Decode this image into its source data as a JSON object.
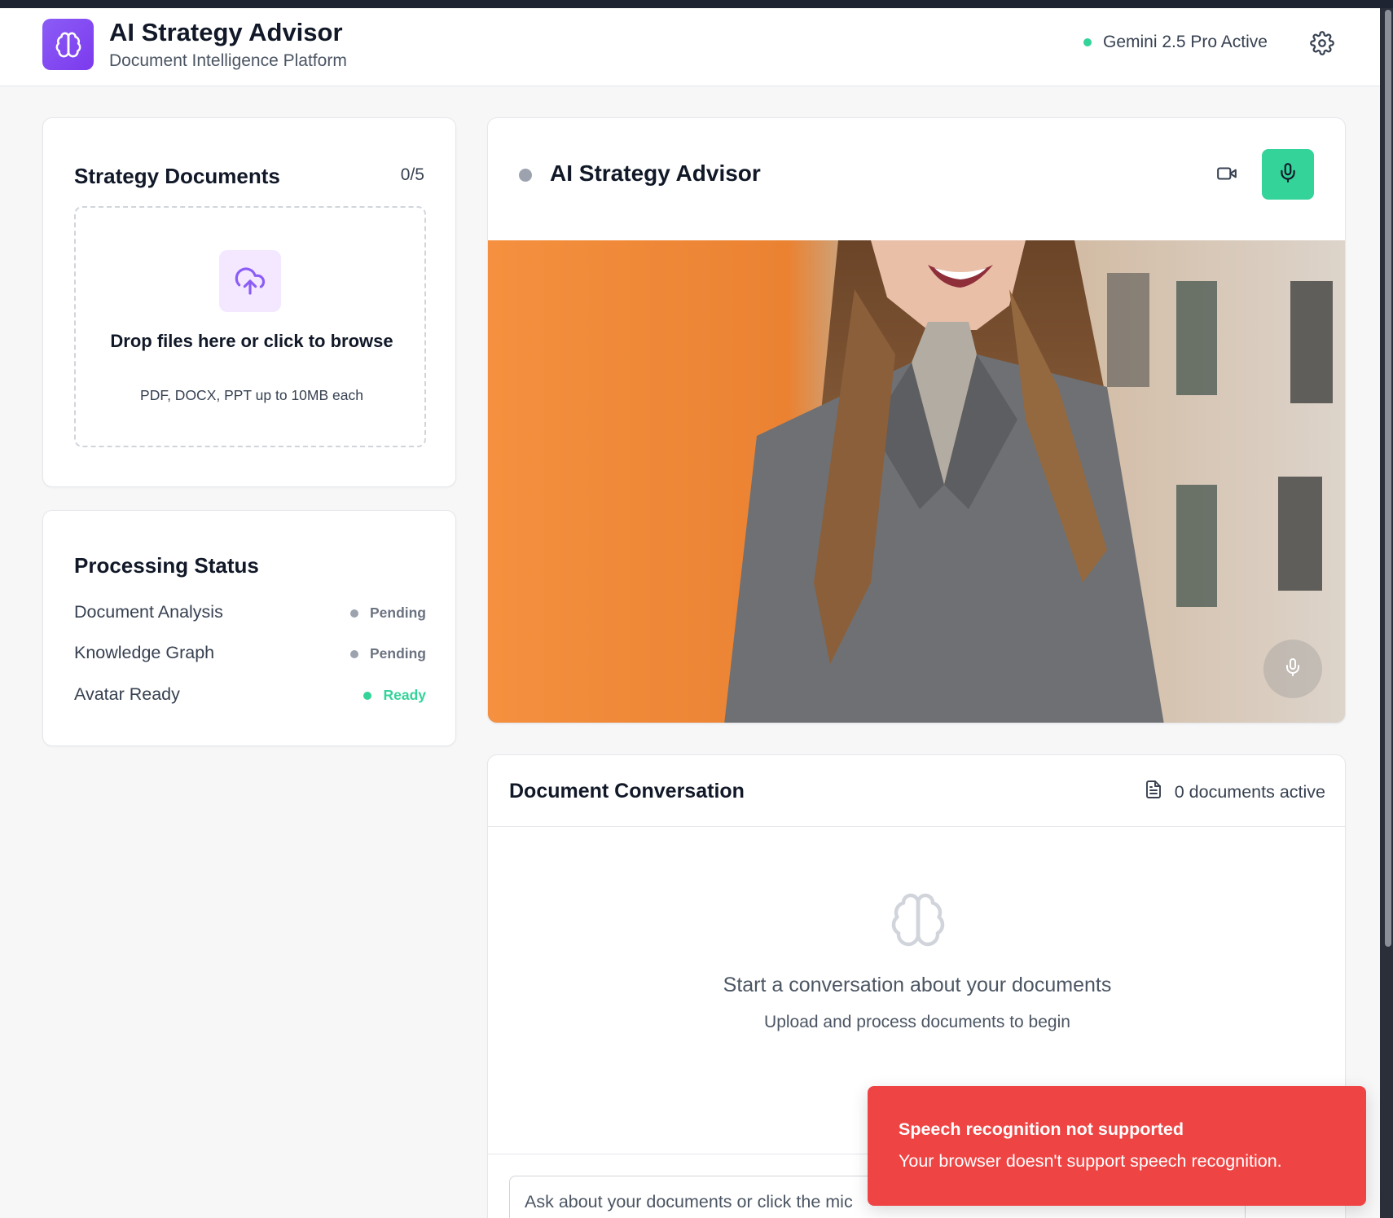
{
  "header": {
    "title": "AI Strategy Advisor",
    "subtitle": "Document Intelligence Platform",
    "model_status": "Gemini 2.5 Pro Active",
    "logo_icon": "brain-icon",
    "settings_icon": "gear-icon"
  },
  "documents": {
    "title": "Strategy Documents",
    "count": "0/5",
    "drop_text": "Drop files here or click to browse",
    "drop_subtext": "PDF, DOCX, PPT up to 10MB each",
    "upload_icon": "cloud-upload-icon"
  },
  "processing": {
    "title": "Processing Status",
    "items": [
      {
        "label": "Document Analysis",
        "state": "Pending"
      },
      {
        "label": "Knowledge Graph",
        "state": "Pending"
      },
      {
        "label": "Avatar Ready",
        "state": "Ready"
      }
    ]
  },
  "advisor": {
    "title": "AI Strategy Advisor",
    "video_icon": "video-camera-icon",
    "mic_icon": "microphone-icon"
  },
  "conversation": {
    "title": "Document Conversation",
    "docs_active": "0 documents active",
    "empty_title": "Start a conversation about your documents",
    "empty_subtitle": "Upload and process documents to begin",
    "input_placeholder": "Ask about your documents or click the mic"
  },
  "toast": {
    "title": "Speech recognition not supported",
    "message": "Your browser doesn't support speech recognition."
  },
  "colors": {
    "brand": "#7c3aed",
    "accent_green": "#34d399",
    "toast_red": "#ef4444",
    "pending_gray": "#9ca3af"
  }
}
